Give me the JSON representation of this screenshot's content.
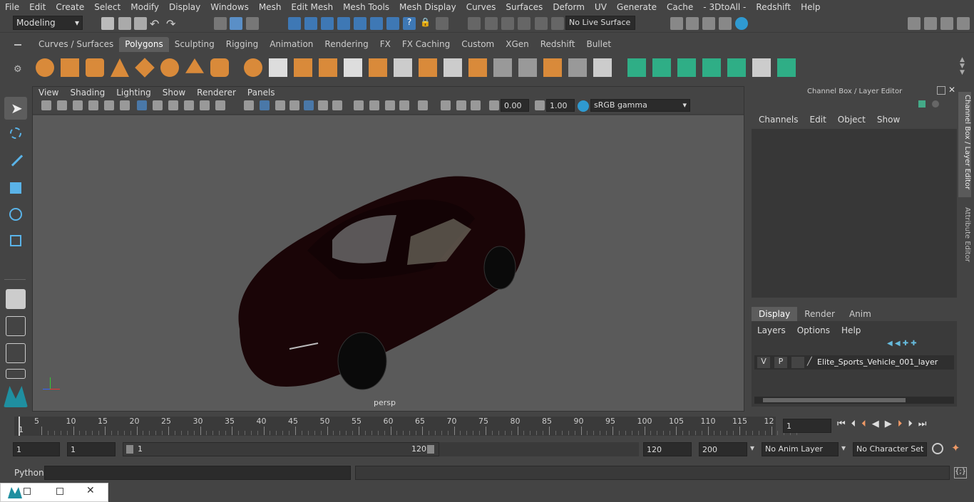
{
  "menu": [
    "File",
    "Edit",
    "Create",
    "Select",
    "Modify",
    "Display",
    "Windows",
    "Mesh",
    "Edit Mesh",
    "Mesh Tools",
    "Mesh Display",
    "Curves",
    "Surfaces",
    "Deform",
    "UV",
    "Generate",
    "Cache",
    "- 3DtoAll -",
    "Redshift",
    "Help"
  ],
  "workspace": "Modeling",
  "live_surface": "No Live Surface",
  "shelf_tabs": [
    "Curves / Surfaces",
    "Polygons",
    "Sculpting",
    "Rigging",
    "Animation",
    "Rendering",
    "FX",
    "FX Caching",
    "Custom",
    "XGen",
    "Redshift",
    "Bullet"
  ],
  "active_shelf": "Polygons",
  "viewport_menu": [
    "View",
    "Shading",
    "Lighting",
    "Show",
    "Renderer",
    "Panels"
  ],
  "viewport": {
    "exposure": "0.00",
    "gamma": "1.00",
    "colorspace": "sRGB gamma",
    "camera": "persp"
  },
  "right": {
    "title": "Channel Box / Layer Editor",
    "menus": [
      "Channels",
      "Edit",
      "Object",
      "Show"
    ],
    "tabs": [
      "Display",
      "Render",
      "Anim"
    ],
    "layer_menus": [
      "Layers",
      "Options",
      "Help"
    ],
    "layer": {
      "v": "V",
      "p": "P",
      "name": "Elite_Sports_Vehicle_001_layer"
    },
    "side_tabs": [
      "Channel Box / Layer Editor",
      "Attribute Editor"
    ]
  },
  "timeline": {
    "ticks": [
      "5",
      "10",
      "15",
      "20",
      "25",
      "30",
      "35",
      "40",
      "45",
      "50",
      "55",
      "60",
      "65",
      "70",
      "75",
      "80",
      "85",
      "90",
      "95",
      "100",
      "105",
      "110",
      "115",
      "12"
    ],
    "start_label": "1",
    "current": "1"
  },
  "range": {
    "start": "1",
    "start2": "1",
    "slider_start": "1",
    "slider_end": "120",
    "end": "120",
    "end2": "200",
    "anim_layer": "No Anim Layer",
    "char_set": "No Character Set"
  },
  "cmd": {
    "label": "Python"
  }
}
